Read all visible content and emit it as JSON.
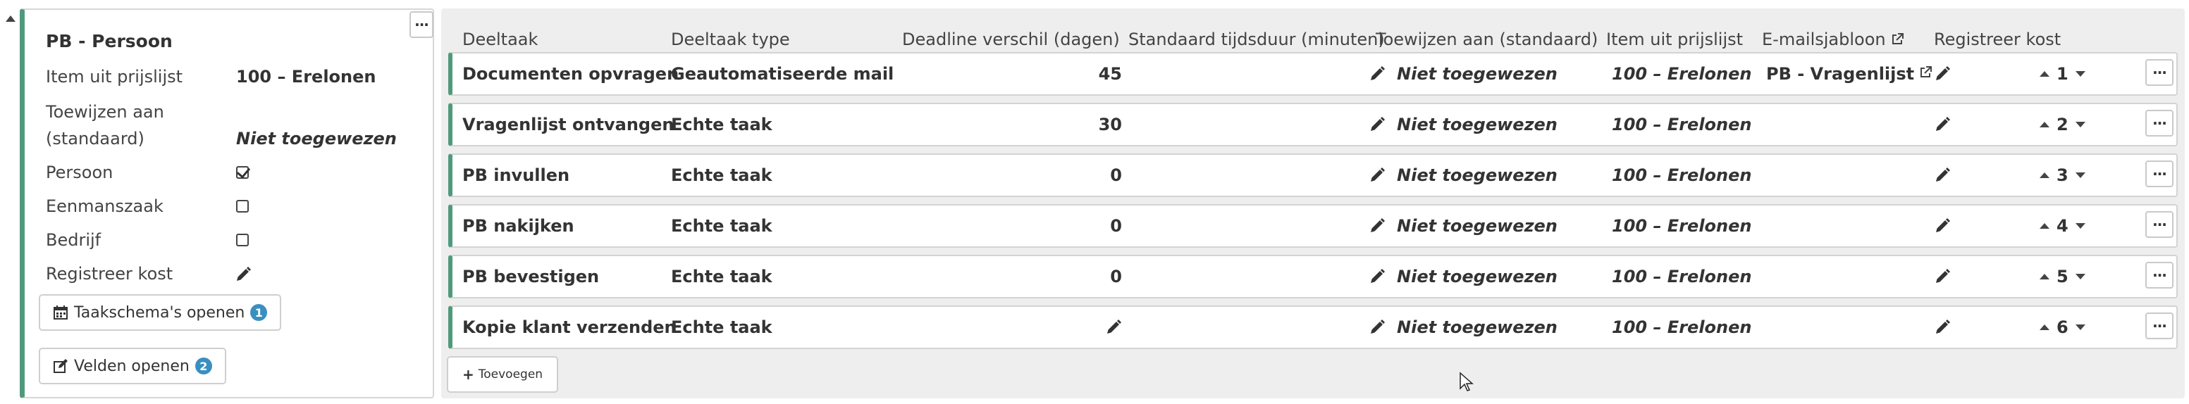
{
  "panel": {
    "title": "PB - Persoon",
    "fields": [
      {
        "label": "Item uit prijslijst",
        "value": "100 – Erelonen"
      },
      {
        "label_line1": "Toewijzen aan",
        "label_line2": "(standaard)",
        "value": "Niet toegewezen"
      },
      {
        "label": "Persoon",
        "checked": true
      },
      {
        "label": "Eenmanszaak",
        "checked": false
      },
      {
        "label": "Bedrijf",
        "checked": false
      },
      {
        "label": "Registreer kost",
        "icon": "pencil-icon"
      }
    ],
    "buttons": [
      {
        "label": "Taakschema's openen",
        "badge": "1",
        "icon": "calendar-icon"
      },
      {
        "label": "Velden openen",
        "badge": "2",
        "icon": "edit-icon"
      }
    ]
  },
  "table": {
    "headers": [
      "Deeltaak",
      "Deeltaak type",
      "Deadline verschil (dagen)",
      "Standaard tijdsduur (minuten)",
      "Toewijzen aan (standaard)",
      "Item uit prijslijst",
      "E-mailsjabloon",
      "Registreer kost"
    ],
    "rows": [
      {
        "name": "Documenten opvragen",
        "type": "Geautomatiseerde mail",
        "deadline": "45",
        "assign": "Niet toegewezen",
        "item": "100 – Erelonen",
        "email": "PB - Vragenlijst",
        "order": "1"
      },
      {
        "name": "Vragenlijst ontvangen",
        "type": "Echte taak",
        "deadline": "30",
        "assign": "Niet toegewezen",
        "item": "100 – Erelonen",
        "email": "",
        "order": "2"
      },
      {
        "name": "PB invullen",
        "type": "Echte taak",
        "deadline": "0",
        "assign": "Niet toegewezen",
        "item": "100 – Erelonen",
        "email": "",
        "order": "3"
      },
      {
        "name": "PB nakijken",
        "type": "Echte taak",
        "deadline": "0",
        "assign": "Niet toegewezen",
        "item": "100 – Erelonen",
        "email": "",
        "order": "4"
      },
      {
        "name": "PB bevestigen",
        "type": "Echte taak",
        "deadline": "0",
        "assign": "Niet toegewezen",
        "item": "100 – Erelonen",
        "email": "",
        "order": "5"
      },
      {
        "name": "Kopie klant verzenden",
        "type": "Echte taak",
        "deadline": "",
        "assign": "Niet toegewezen",
        "item": "100 – Erelonen",
        "email": "",
        "order": "6"
      }
    ],
    "add_label": "Toevoegen"
  },
  "colors": {
    "accent": "#4f9a7c",
    "badge": "#3a8fc0",
    "area_bg": "#eeeeee"
  },
  "icons": {
    "edit": "pencil-icon",
    "external": "external-link-icon",
    "more": "more-icon",
    "checkbox": "checkbox-icon"
  }
}
